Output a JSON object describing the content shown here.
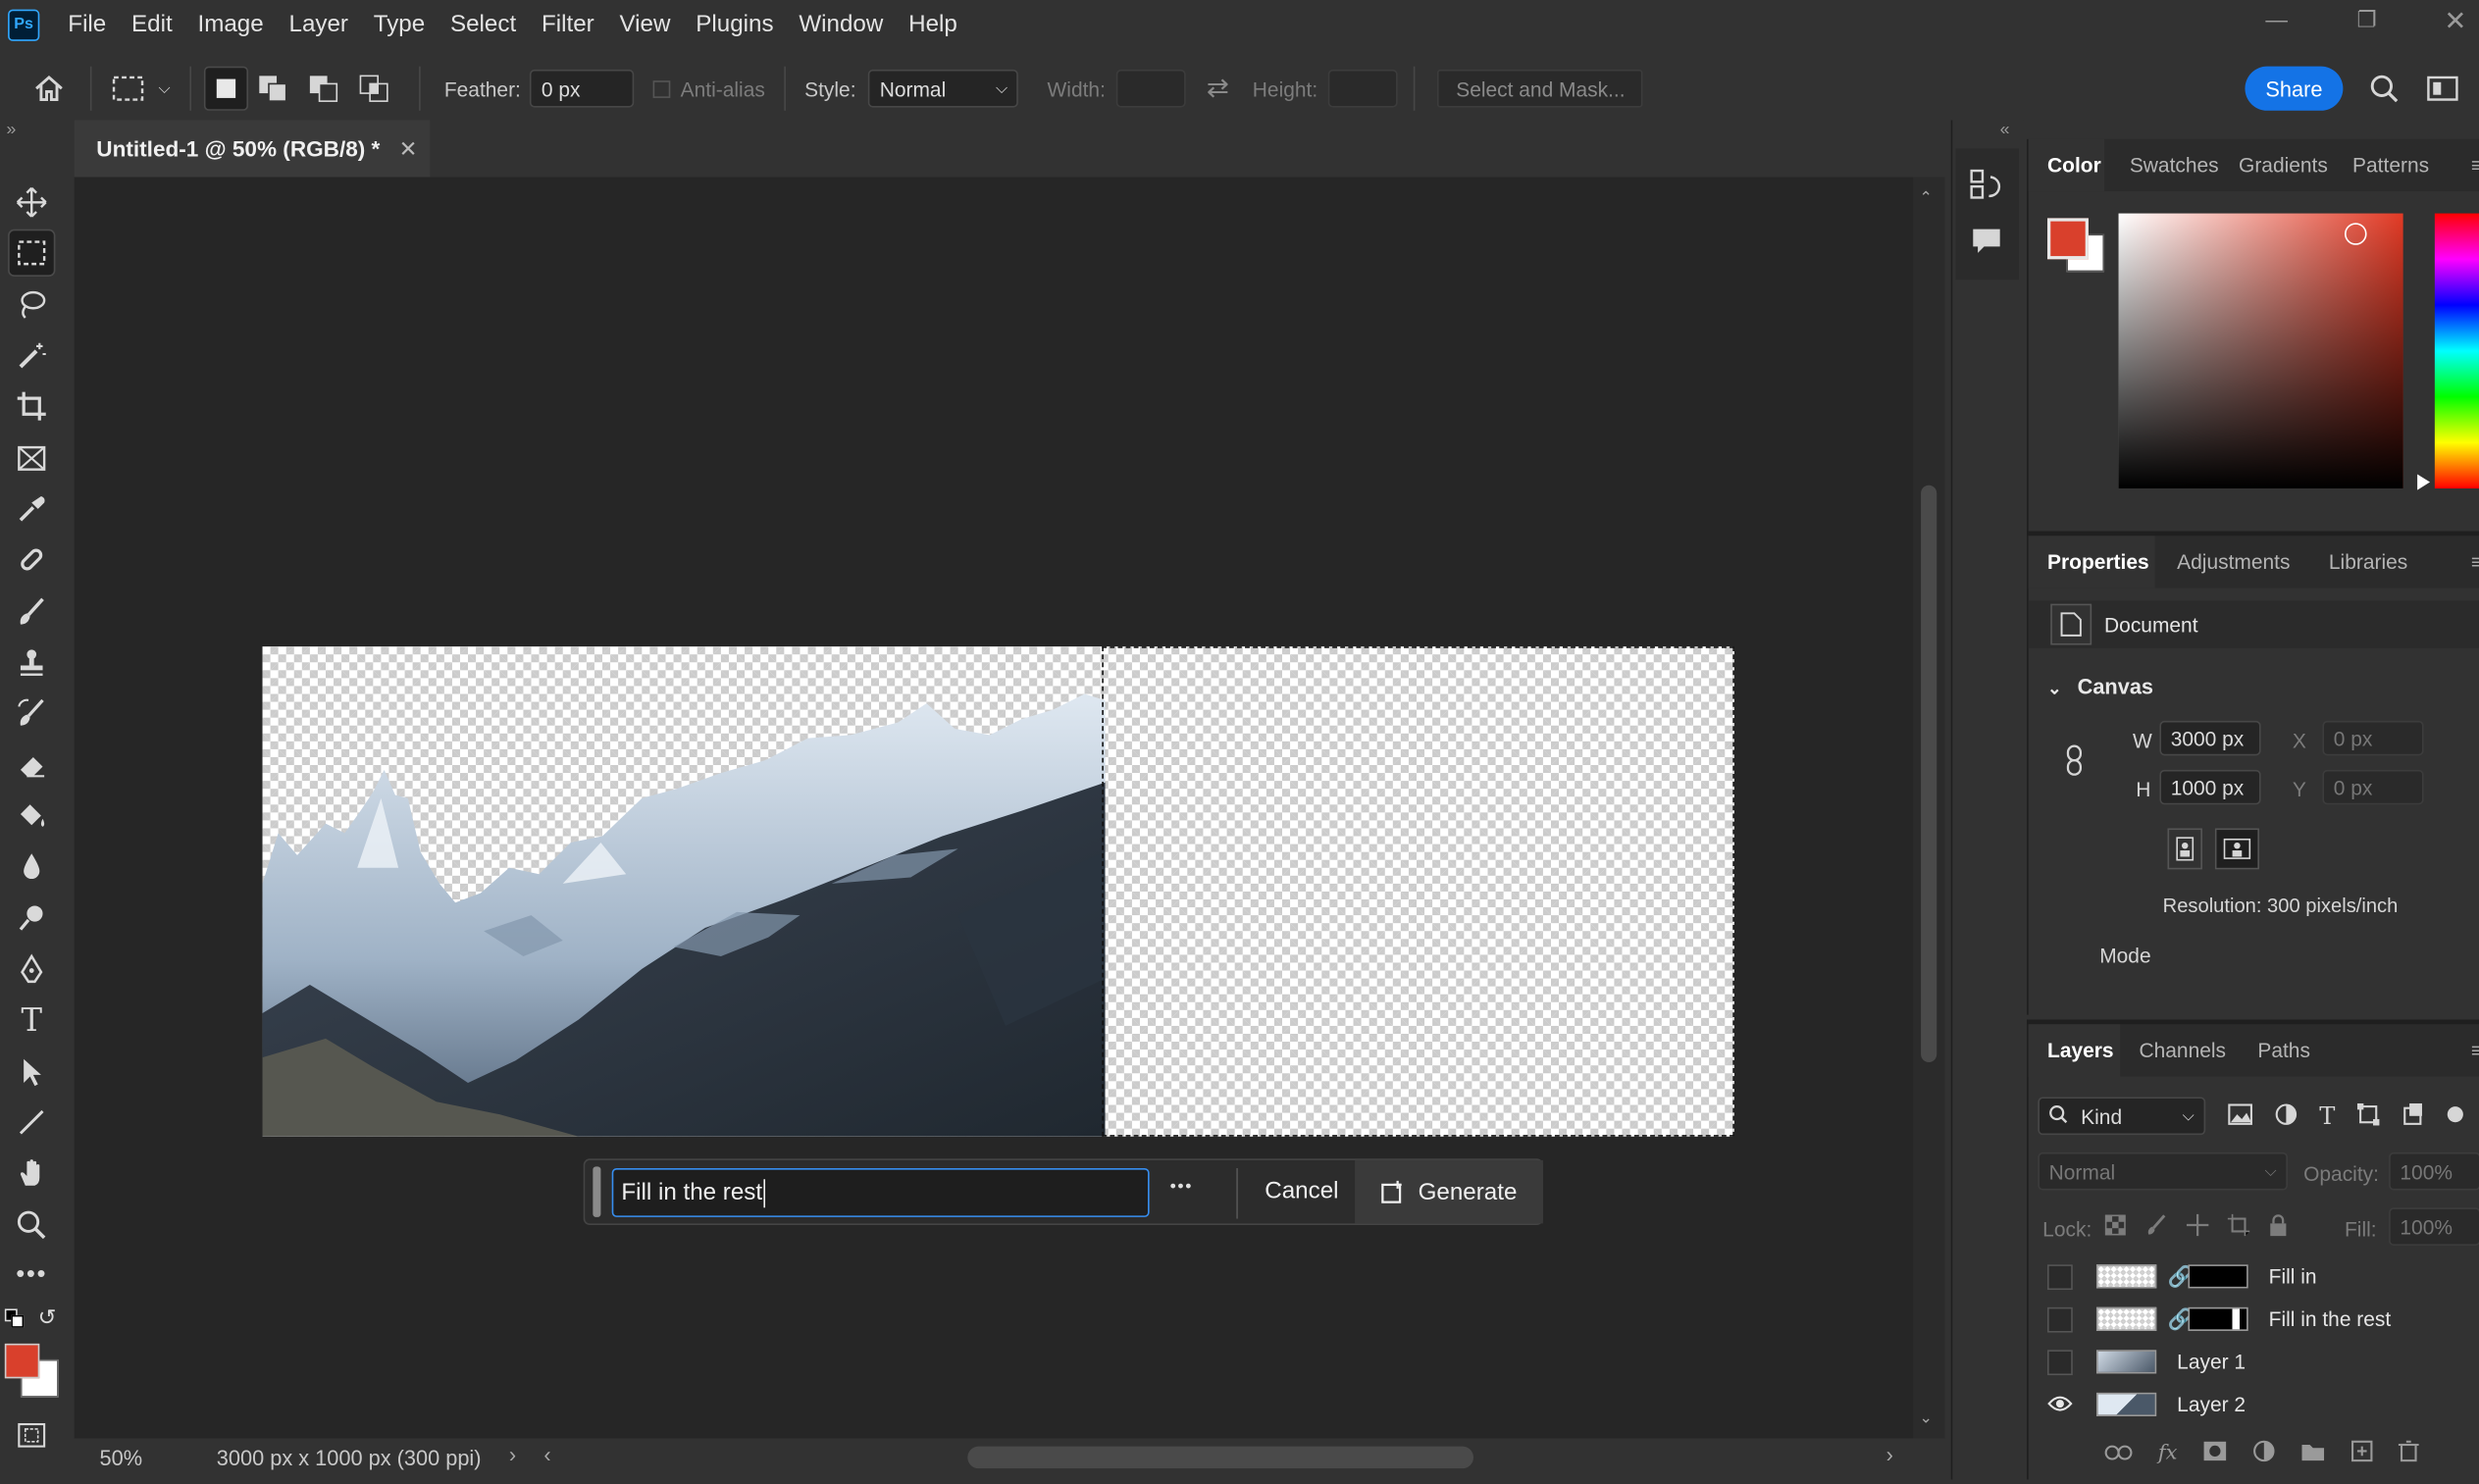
{
  "app": {
    "name": "Ps"
  },
  "menu": [
    "File",
    "Edit",
    "Image",
    "Layer",
    "Type",
    "Select",
    "Filter",
    "View",
    "Plugins",
    "Window",
    "Help"
  ],
  "options": {
    "feather_label": "Feather:",
    "feather_value": "0 px",
    "antialias_label": "Anti-alias",
    "style_label": "Style:",
    "style_value": "Normal",
    "width_label": "Width:",
    "height_label": "Height:",
    "select_mask_label": "Select and Mask...",
    "share_label": "Share"
  },
  "document": {
    "tab_title": "Untitled-1 @ 50% (RGB/8) *",
    "zoom": "50%",
    "info": "3000 px x 1000 px (300 ppi)"
  },
  "generative_bar": {
    "prompt_value": "Fill in the rest",
    "more_label": "•••",
    "cancel_label": "Cancel",
    "generate_label": "Generate"
  },
  "colors": {
    "foreground": "#d9402c",
    "background": "#ffffff",
    "accent": "#1473e6",
    "hue": "#e23a25"
  },
  "color_panel": {
    "tabs": [
      "Color",
      "Swatches",
      "Gradients",
      "Patterns"
    ]
  },
  "properties_panel": {
    "tabs": [
      "Properties",
      "Adjustments",
      "Libraries"
    ],
    "document_label": "Document",
    "canvas_label": "Canvas",
    "w_label": "W",
    "w_value": "3000 px",
    "h_label": "H",
    "h_value": "1000 px",
    "x_label": "X",
    "x_value": "0 px",
    "y_label": "Y",
    "y_value": "0 px",
    "resolution": "Resolution: 300 pixels/inch",
    "mode_label": "Mode"
  },
  "layers_panel": {
    "tabs": [
      "Layers",
      "Channels",
      "Paths"
    ],
    "kind_label": "Kind",
    "blend_mode": "Normal",
    "opacity_label": "Opacity:",
    "opacity_value": "100%",
    "lock_label": "Lock:",
    "fill_label": "Fill:",
    "fill_value": "100%",
    "layers": [
      {
        "name": "Fill in",
        "visible": false,
        "has_mask": true
      },
      {
        "name": "Fill in the rest",
        "visible": false,
        "has_mask": true
      },
      {
        "name": "Layer 1",
        "visible": false,
        "has_mask": false
      },
      {
        "name": "Layer 2",
        "visible": true,
        "has_mask": false
      }
    ]
  },
  "icons": {
    "toolbar": [
      "move-icon",
      "marquee-icon",
      "lasso-icon",
      "magic-wand-icon",
      "crop-icon",
      "frame-icon",
      "eyedropper-icon",
      "healing-icon",
      "brush-icon",
      "stamp-icon",
      "history-brush-icon",
      "eraser-icon",
      "paint-bucket-icon",
      "blur-icon",
      "dodge-icon",
      "pen-icon",
      "type-icon",
      "path-selection-icon",
      "line-icon",
      "hand-icon",
      "zoom-icon",
      "more-tools-icon"
    ]
  }
}
